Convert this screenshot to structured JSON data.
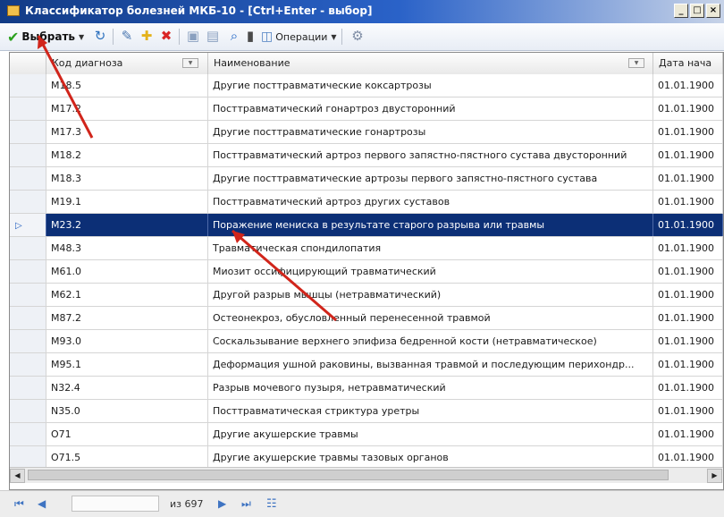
{
  "window": {
    "title": "Классификатор болезней МКБ-10 - [Ctrl+Enter - выбор]"
  },
  "toolbar": {
    "select_label": "Выбрать",
    "operations_label": "Операции"
  },
  "icons": [
    "check-icon",
    "refresh-icon",
    "edit-icon",
    "add-icon",
    "delete-icon",
    "save-icon",
    "duplicate-icon",
    "search-icon",
    "filter-icon",
    "operations-icon",
    "settings-icon"
  ],
  "columns": [
    "Код диагноза",
    "Наименование",
    "Дата нача"
  ],
  "rows": [
    {
      "code": "M18.5",
      "name": "Другие посттравматические коксартрозы",
      "date": "01.01.1900"
    },
    {
      "code": "M17.2",
      "name": "Посттравматический гонартроз двусторонний",
      "date": "01.01.1900"
    },
    {
      "code": "M17.3",
      "name": "Другие посттравматические гонартрозы",
      "date": "01.01.1900"
    },
    {
      "code": "M18.2",
      "name": "Посттравматический артроз первого запястно-пястного сустава двусторонний",
      "date": "01.01.1900"
    },
    {
      "code": "M18.3",
      "name": "Другие посттравматические артрозы первого запястно-пястного сустава",
      "date": "01.01.1900"
    },
    {
      "code": "M19.1",
      "name": "Посттравматический артроз других суставов",
      "date": "01.01.1900"
    },
    {
      "code": "M23.2",
      "name": "Поражение мениска в результате старого разрыва или травмы",
      "date": "01.01.1900",
      "selected": true
    },
    {
      "code": "M48.3",
      "name": "Травматическая спондилопатия",
      "date": "01.01.1900"
    },
    {
      "code": "M61.0",
      "name": "Миозит оссифицирующий травматический",
      "date": "01.01.1900"
    },
    {
      "code": "M62.1",
      "name": "Другой разрыв мышцы (нетравматический)",
      "date": "01.01.1900"
    },
    {
      "code": "M87.2",
      "name": "Остеонекроз, обусловленный перенесенной травмой",
      "date": "01.01.1900"
    },
    {
      "code": "M93.0",
      "name": "Соскальзывание верхнего эпифиза бедренной кости (нетравматическое)",
      "date": "01.01.1900"
    },
    {
      "code": "M95.1",
      "name": "Деформация ушной раковины, вызванная травмой и последующим перихондр...",
      "date": "01.01.1900"
    },
    {
      "code": "N32.4",
      "name": "Разрыв мочевого пузыря, нетравматический",
      "date": "01.01.1900"
    },
    {
      "code": "N35.0",
      "name": "Посттравматическая стриктура уретры",
      "date": "01.01.1900"
    },
    {
      "code": "O71",
      "name": "Другие акушерские травмы",
      "date": "01.01.1900"
    },
    {
      "code": "O71.5",
      "name": "Другие акушерские травмы тазовых органов",
      "date": "01.01.1900"
    }
  ],
  "pager": {
    "of_text": "из 697"
  },
  "colors": {
    "selected_row": "#0c2f76",
    "annotation_arrow": "#d1251b"
  }
}
